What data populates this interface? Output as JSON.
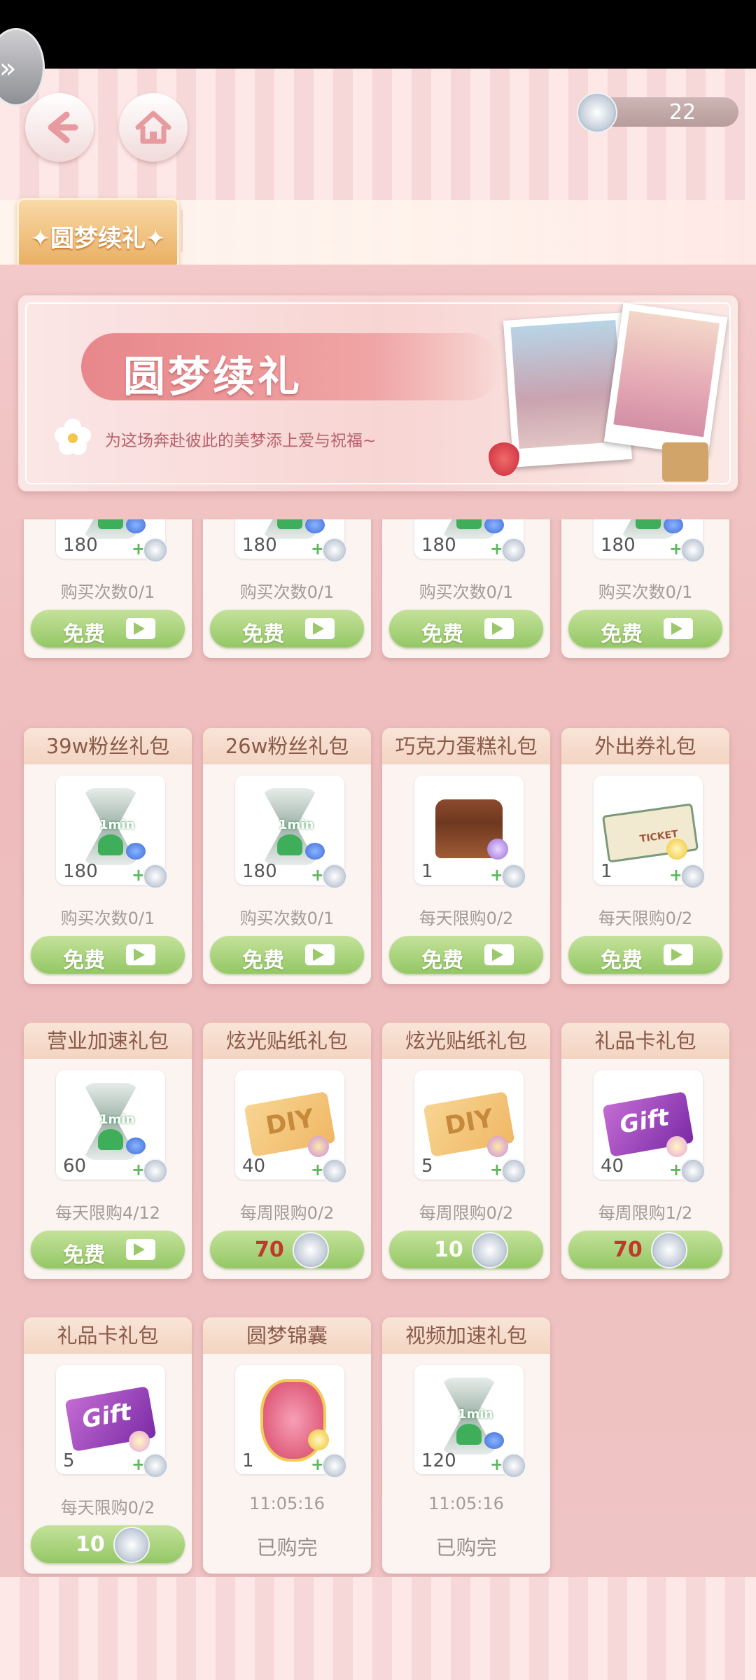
{
  "header": {
    "back_icon": "back-arrow-icon",
    "home_icon": "home-icon",
    "currency": {
      "icon": "silver-coin-icon",
      "amount": "22"
    }
  },
  "tabs": [
    {
      "label": "✦圆梦续礼✦",
      "active": true
    }
  ],
  "banner": {
    "title": "圆梦续礼",
    "subtitle": "为这场奔赴彼此的美梦添上爱与祝福~"
  },
  "colors": {
    "price_red": "#c0392b",
    "price_white": "#ffffff",
    "button_green": "#9ac86a",
    "tab_gold": "#e9ae61"
  },
  "cards": [
    {
      "title": "",
      "item": "hourglass",
      "qty": "180",
      "limit": "购买次数0/1",
      "button": {
        "type": "free",
        "label": "免费"
      }
    },
    {
      "title": "",
      "item": "hourglass",
      "qty": "180",
      "limit": "购买次数0/1",
      "button": {
        "type": "free",
        "label": "免费"
      }
    },
    {
      "title": "",
      "item": "hourglass",
      "qty": "180",
      "limit": "购买次数0/1",
      "button": {
        "type": "free",
        "label": "免费"
      }
    },
    {
      "title": "",
      "item": "hourglass",
      "qty": "180",
      "limit": "购买次数0/1",
      "button": {
        "type": "free",
        "label": "免费"
      }
    },
    {
      "title": "39w粉丝礼包",
      "item": "hourglass",
      "qty": "180",
      "limit": "购买次数0/1",
      "button": {
        "type": "free",
        "label": "免费"
      }
    },
    {
      "title": "26w粉丝礼包",
      "item": "hourglass",
      "qty": "180",
      "limit": "购买次数0/1",
      "button": {
        "type": "free",
        "label": "免费"
      }
    },
    {
      "title": "巧克力蛋糕礼包",
      "item": "cake",
      "qty": "1",
      "limit": "每天限购0/2",
      "button": {
        "type": "free",
        "label": "免费"
      }
    },
    {
      "title": "外出券礼包",
      "item": "ticket",
      "qty": "1",
      "limit": "每天限购0/2",
      "button": {
        "type": "free",
        "label": "免费"
      }
    },
    {
      "title": "营业加速礼包",
      "item": "hourglass",
      "qty": "60",
      "limit": "每天限购4/12",
      "button": {
        "type": "free",
        "label": "免费"
      }
    },
    {
      "title": "炫光贴纸礼包",
      "item": "diy",
      "qty": "40",
      "limit": "每周限购0/2",
      "button": {
        "type": "price",
        "price": "70",
        "price_color": "#c0392b"
      }
    },
    {
      "title": "炫光贴纸礼包",
      "item": "diy",
      "qty": "5",
      "limit": "每周限购0/2",
      "button": {
        "type": "price",
        "price": "10",
        "price_color": "#ffffff"
      }
    },
    {
      "title": "礼品卡礼包",
      "item": "gift",
      "qty": "40",
      "limit": "每周限购1/2",
      "button": {
        "type": "price",
        "price": "70",
        "price_color": "#c0392b"
      }
    },
    {
      "title": "礼品卡礼包",
      "item": "gift",
      "qty": "5",
      "limit": "每天限购0/2",
      "button": {
        "type": "price",
        "price": "10",
        "price_color": "#ffffff"
      }
    },
    {
      "title": "圆梦锦囊",
      "item": "pouch",
      "qty": "1",
      "limit": "11:05:16",
      "button": {
        "type": "soldout",
        "label": "已购完"
      }
    },
    {
      "title": "视频加速礼包",
      "item": "hourglass",
      "qty": "120",
      "limit": "11:05:16",
      "button": {
        "type": "soldout",
        "label": "已购完"
      }
    }
  ],
  "item_text": {
    "hourglass": "1min",
    "ticket": "TICKET",
    "diy": "DIY",
    "gift": "Gift"
  }
}
